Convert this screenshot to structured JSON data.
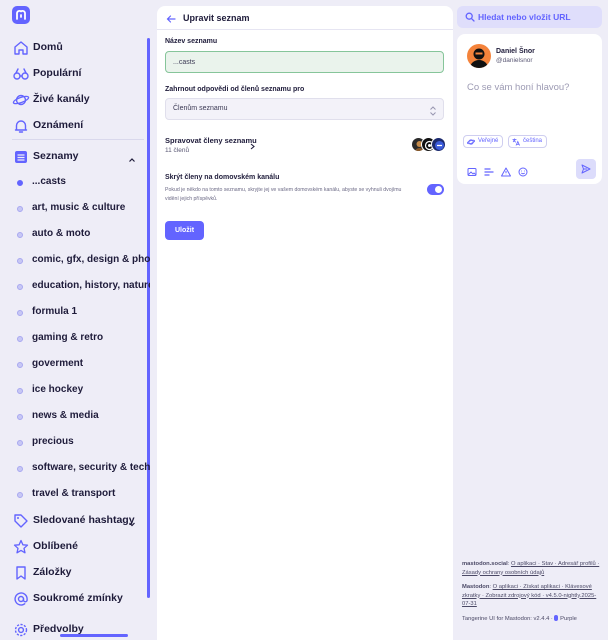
{
  "colors": {
    "accent": "#6364ff",
    "background": "#eeedf7",
    "toggle_on": "#6364ff",
    "name_input_border": "#86c59a"
  },
  "nav": {
    "logo": "mastodon-logo",
    "items": [
      {
        "label": "Domů",
        "icon": "home-icon"
      },
      {
        "label": "Populární",
        "icon": "explore-icon"
      },
      {
        "label": "Živé kanály",
        "icon": "live-feeds-icon"
      },
      {
        "label": "Oznámení",
        "icon": "bell-icon"
      },
      {
        "label": "Seznamy",
        "icon": "list-icon"
      }
    ],
    "lists": [
      "...casts",
      "art, music & culture",
      "auto & moto",
      "comic, gfx, design & photo",
      "education, history, nature &",
      "formula 1",
      "gaming & retro",
      "goverment",
      "ice hockey",
      "news & media",
      "precious",
      "software, security & tech",
      "travel & transport"
    ],
    "active_list": "...casts",
    "bottom_items": [
      {
        "label": "Sledované hashtagy",
        "icon": "hashtag-icon"
      },
      {
        "label": "Oblíbené",
        "icon": "star-icon"
      },
      {
        "label": "Záložky",
        "icon": "bookmark-icon"
      },
      {
        "label": "Soukromé zmínky",
        "icon": "at-icon"
      },
      {
        "label": "Předvolby",
        "icon": "gear-icon"
      }
    ]
  },
  "edit_list": {
    "title": "Upravit seznam",
    "name_label": "Název seznamu",
    "name_value": "...casts",
    "replies_label": "Zahrnout odpovědi od členů seznamu pro",
    "replies_value": "Členům seznamu",
    "manage_label": "Spravovat členy seznamu",
    "member_count": "11 členů",
    "hide_label": "Skrýt členy na domovském kanálu",
    "hide_desc": "Pokud je někdo na tomto seznamu, skryjte jej ve vašem domovském kanálu, abyste se vyhnuli dvojímu vidění jejich příspěvků.",
    "hide_toggle_on": true,
    "save_label": "Uložit"
  },
  "search": {
    "placeholder": "Hledat nebo vložit URL"
  },
  "compose": {
    "display_name": "Daniel Šnor",
    "handle": "@danielsnor",
    "placeholder": "Co se vám honí hlavou?",
    "visibility": "Veřejné",
    "language": "čeština",
    "tools": [
      "image-icon",
      "poll-icon",
      "warning-icon",
      "emoji-icon"
    ],
    "send_icon": "send-icon"
  },
  "footer": {
    "server": "mastodon.social",
    "server_links": "O aplikaci · Stav · Adresář profilů · Zásady ochrany osobních údajů",
    "mastodon": "Mastodon",
    "mastodon_links": "O aplikaci · Získat aplikaci · Klávesové zkratky · Zobrazit zdrojový kód · v4.5.0-nightly.2025-07-31",
    "theme": "Tangerine UI for Mastodon: v2.4.4 · ",
    "theme_variant": "Purple"
  }
}
